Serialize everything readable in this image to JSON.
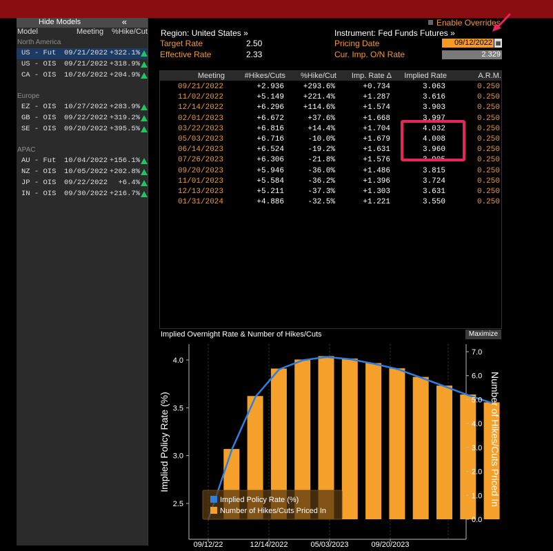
{
  "left_panel": {
    "hide_label": "Hide Models",
    "collapse_glyph": "«",
    "columns": [
      "Model",
      "Meeting",
      "%Hike/Cut"
    ],
    "groups": [
      {
        "name": "North America",
        "rows": [
          {
            "model": "US - Fut",
            "meeting": "09/21/2022",
            "value": "+322.1%",
            "selected": true
          },
          {
            "model": "US - OIS",
            "meeting": "09/21/2022",
            "value": "+318.9%"
          },
          {
            "model": "CA - OIS",
            "meeting": "10/26/2022",
            "value": "+204.9%"
          }
        ]
      },
      {
        "name": "Europe",
        "rows": [
          {
            "model": "EZ - OIS",
            "meeting": "10/27/2022",
            "value": "+283.9%"
          },
          {
            "model": "GB - OIS",
            "meeting": "09/22/2022",
            "value": "+319.2%"
          },
          {
            "model": "SE - OIS",
            "meeting": "09/20/2022",
            "value": "+395.5%"
          }
        ]
      },
      {
        "name": "APAC",
        "rows": [
          {
            "model": "AU - Fut",
            "meeting": "10/04/2022",
            "value": "+156.1%"
          },
          {
            "model": "NZ - OIS",
            "meeting": "10/05/2022",
            "value": "+202.8%"
          },
          {
            "model": "JP - OIS",
            "meeting": "09/22/2022",
            "value": "+6.4%"
          },
          {
            "model": "IN - OIS",
            "meeting": "09/30/2022",
            "value": "+216.7%"
          }
        ]
      }
    ]
  },
  "header": {
    "region": "Region: United States »",
    "instrument": "Instrument: Fed Funds Futures »",
    "enable_overrides": "Enable Overrides",
    "target_rate_label": "Target Rate",
    "target_rate": "2.50",
    "effective_rate_label": "Effective Rate",
    "effective_rate": "2.33",
    "pricing_date_label": "Pricing Date",
    "pricing_date": "09/12/2022",
    "cur_imp_label": "Cur. Imp. O/N Rate",
    "cur_imp": "2.329"
  },
  "table": {
    "columns": [
      "Meeting",
      "#Hikes/Cuts",
      "%Hike/Cut",
      "Imp. Rate Δ",
      "Implied Rate",
      "A.R.M."
    ],
    "rows": [
      [
        "09/21/2022",
        "+2.936",
        "+293.6%",
        "+0.734",
        "3.063",
        "0.250"
      ],
      [
        "11/02/2022",
        "+5.149",
        "+221.4%",
        "+1.287",
        "3.616",
        "0.250"
      ],
      [
        "12/14/2022",
        "+6.296",
        "+114.6%",
        "+1.574",
        "3.903",
        "0.250"
      ],
      [
        "02/01/2023",
        "+6.672",
        "+37.6%",
        "+1.668",
        "3.997",
        "0.250"
      ],
      [
        "03/22/2023",
        "+6.816",
        "+14.4%",
        "+1.704",
        "4.032",
        "0.250"
      ],
      [
        "05/03/2023",
        "+6.716",
        "-10.0%",
        "+1.679",
        "4.008",
        "0.250"
      ],
      [
        "06/14/2023",
        "+6.524",
        "-19.2%",
        "+1.631",
        "3.960",
        "0.250"
      ],
      [
        "07/26/2023",
        "+6.306",
        "-21.8%",
        "+1.576",
        "3.905",
        "0.250"
      ],
      [
        "09/20/2023",
        "+5.946",
        "-36.0%",
        "+1.486",
        "3.815",
        "0.250"
      ],
      [
        "11/01/2023",
        "+5.584",
        "-36.2%",
        "+1.396",
        "3.724",
        "0.250"
      ],
      [
        "12/13/2023",
        "+5.211",
        "-37.3%",
        "+1.303",
        "3.631",
        "0.250"
      ],
      [
        "01/31/2024",
        "+4.886",
        "-32.5%",
        "+1.221",
        "3.550",
        "0.250"
      ]
    ]
  },
  "chart_panel": {
    "title": "Implied Overnight Rate & Number of Hikes/Cuts",
    "maximize_label": "Maximize"
  },
  "chart_data": {
    "type": "bar",
    "x_tick_labels": [
      "09/12/22",
      "12/14/2022",
      "05/03/2023",
      "09/20/2023"
    ],
    "ylabel": "Implied Policy Rate (%)",
    "y2label": "Number of Hikes/Cuts Priced In",
    "ylim": [
      2.5,
      4.0
    ],
    "y_ticks": [
      "4.0",
      "3.5",
      "3.0",
      "2.5"
    ],
    "y2lim": [
      0.0,
      7.0
    ],
    "y2_ticks": [
      "7.0",
      "6.0",
      "5.0",
      "4.0",
      "3.0",
      "2.0",
      "1.0",
      "0.0"
    ],
    "legend": [
      "Implied Policy Rate (%)",
      "Number of Hikes/Cuts Priced In"
    ],
    "legend_position": "bottom-left",
    "colors": {
      "line": "#2f7fe0",
      "bars": "#f5a02a"
    },
    "bars_hikes": [
      2.936,
      5.149,
      6.296,
      6.672,
      6.816,
      6.716,
      6.524,
      6.306,
      5.946,
      5.584,
      5.211,
      4.886
    ],
    "line_rate": [
      2.329,
      3.063,
      3.616,
      3.903,
      3.997,
      4.032,
      4.008,
      3.96,
      3.905,
      3.815,
      3.724,
      3.631,
      3.55
    ]
  }
}
